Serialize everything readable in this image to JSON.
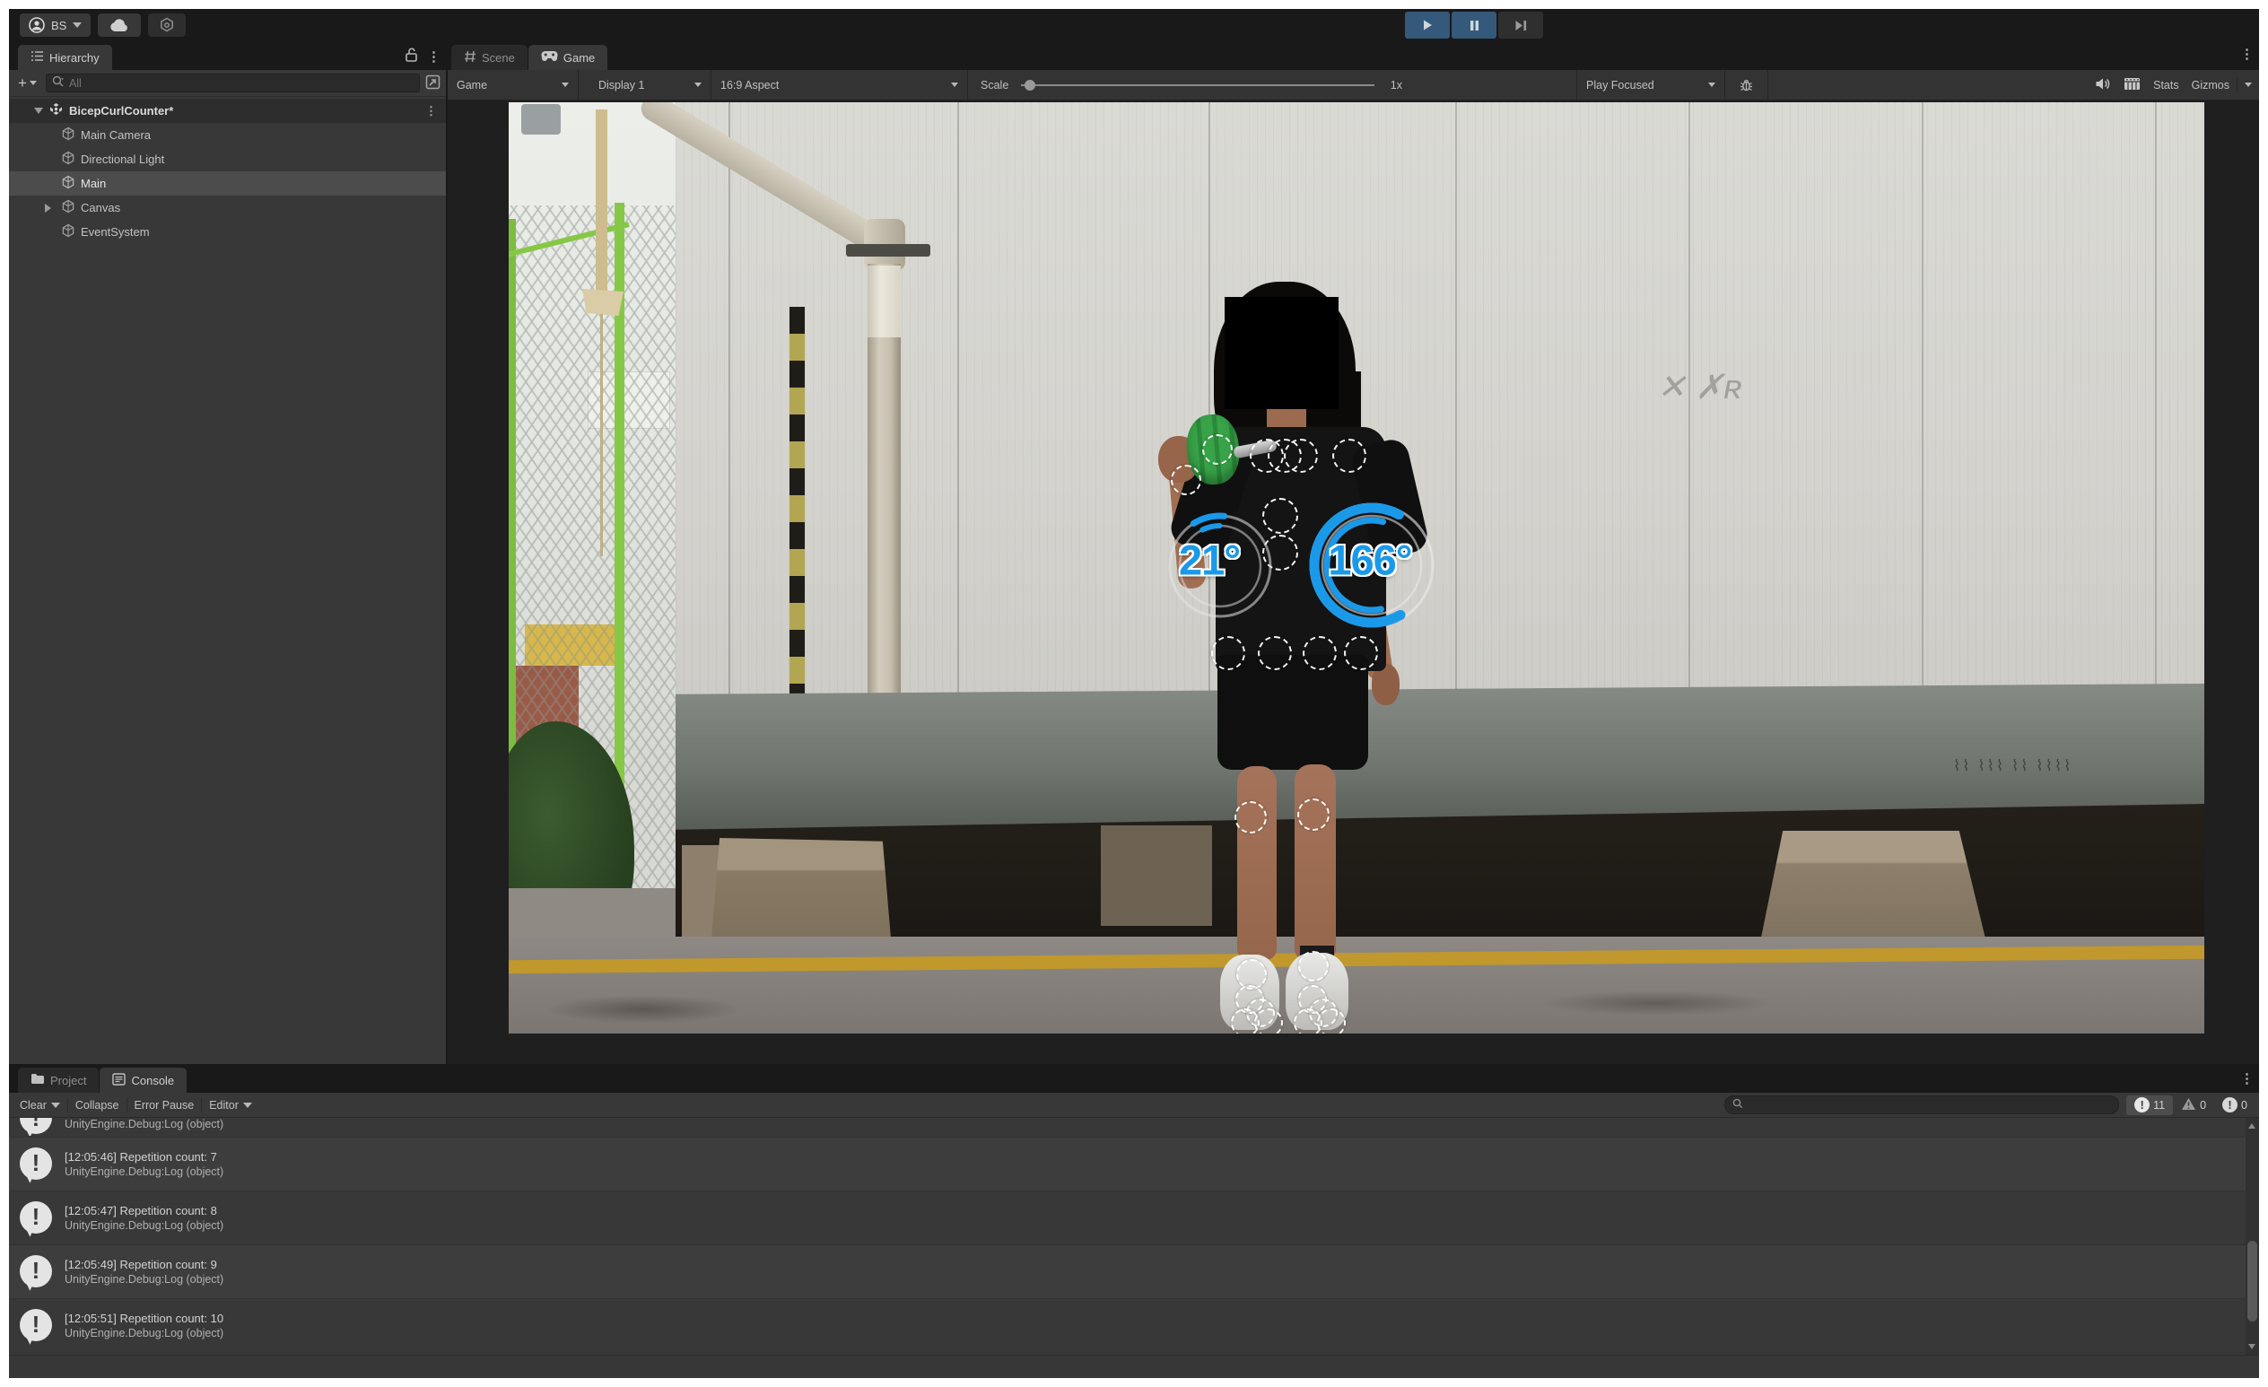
{
  "top_toolbar": {
    "account_label": "BS",
    "account_icon": "avatar-icon",
    "cloud_icon": "cloud-icon",
    "settings_icon": "settings-icon",
    "play_state": {
      "play_active": true,
      "pause_active": true,
      "step_active": false
    }
  },
  "hierarchy": {
    "tab_label": "Hierarchy",
    "search_placeholder": "All",
    "scene_name": "BicepCurlCounter*",
    "items": [
      {
        "label": "Main Camera"
      },
      {
        "label": "Directional Light"
      },
      {
        "label": "Main"
      },
      {
        "label": "Canvas"
      },
      {
        "label": "EventSystem"
      }
    ]
  },
  "game": {
    "tabs": {
      "scene": "Scene",
      "game": "Game"
    },
    "toolbar": {
      "display_target": "Game",
      "display": "Display 1",
      "aspect": "16:9 Aspect",
      "scale_label": "Scale",
      "scale_value": "1x",
      "play_focused": "Play Focused",
      "stats_label": "Stats",
      "gizmos_label": "Gizmos"
    }
  },
  "overlay": {
    "left_angle": "21°",
    "right_angle": "166°",
    "accent_blue": "#1b99e9"
  },
  "console": {
    "tabs": {
      "project": "Project",
      "console": "Console"
    },
    "toolbar": {
      "clear": "Clear",
      "collapse": "Collapse",
      "error_pause": "Error Pause",
      "editor": "Editor"
    },
    "counts": {
      "info": "11",
      "warnings": "0",
      "errors": "0"
    },
    "partial_top": {
      "line2": "UnityEngine.Debug:Log (object)"
    },
    "logs": [
      {
        "line1": "[12:05:46] Repetition count: 7",
        "line2": "UnityEngine.Debug:Log (object)"
      },
      {
        "line1": "[12:05:47] Repetition count: 8",
        "line2": "UnityEngine.Debug:Log (object)"
      },
      {
        "line1": "[12:05:49] Repetition count: 9",
        "line2": "UnityEngine.Debug:Log (object)"
      },
      {
        "line1": "[12:05:51] Repetition count: 10",
        "line2": "UnityEngine.Debug:Log (object)"
      }
    ]
  }
}
